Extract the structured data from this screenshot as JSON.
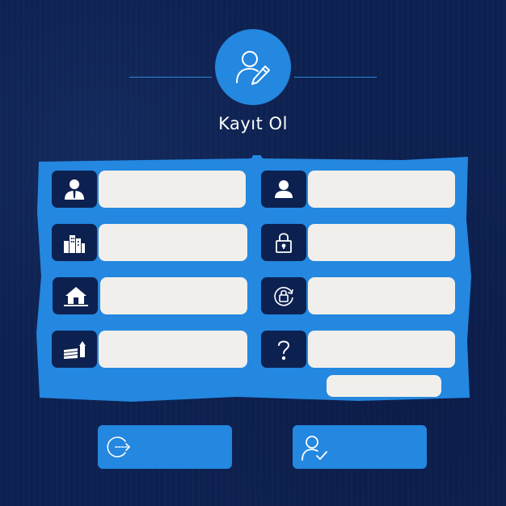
{
  "header": {
    "title": "Kayıt Ol",
    "avatar_icon": "user-edit-icon"
  },
  "form": {
    "left_fields": [
      {
        "icon": "businessman-icon",
        "value": "",
        "placeholder": ""
      },
      {
        "icon": "city-buildings-icon",
        "value": "",
        "placeholder": ""
      },
      {
        "icon": "houses-icon",
        "value": "",
        "placeholder": ""
      },
      {
        "icon": "farm-field-icon",
        "value": "",
        "placeholder": ""
      }
    ],
    "right_fields": [
      {
        "icon": "user-icon",
        "value": "",
        "placeholder": ""
      },
      {
        "icon": "lock-icon",
        "value": "",
        "placeholder": ""
      },
      {
        "icon": "lock-refresh-icon",
        "value": "",
        "placeholder": ""
      },
      {
        "icon": "question-icon",
        "value": "",
        "placeholder": ""
      }
    ],
    "captcha": {
      "value": ""
    }
  },
  "actions": {
    "login_icon": "sign-in-icon",
    "register_icon": "user-check-icon"
  },
  "colors": {
    "background": "#0d2150",
    "accent": "#2487e0",
    "field": "#f1efeb"
  }
}
